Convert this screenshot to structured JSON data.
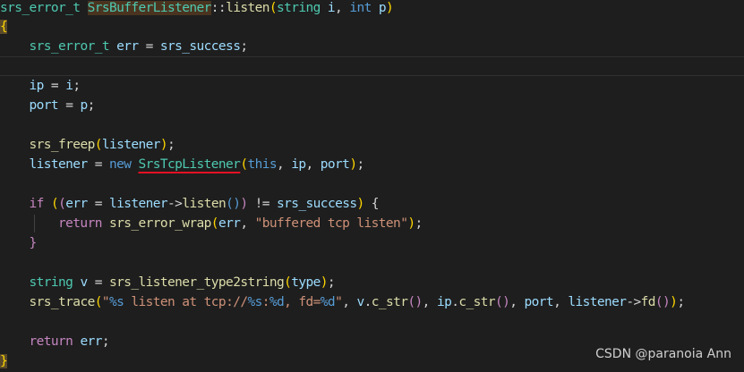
{
  "code": {
    "l1": {
      "ret_type": "srs_error_t",
      "class_name": "SrsBufferListener",
      "sep": "::",
      "method": "listen",
      "open": "(",
      "p1_type": "string",
      "p1_name": "i",
      "comma": ",",
      "p2_type": "int",
      "p2_name": "p",
      "close": ")"
    },
    "l2": {
      "brace": "{"
    },
    "l3": {
      "type": "srs_error_t",
      "var": "err",
      "eq": " = ",
      "val": "srs_success",
      "semi": ";"
    },
    "l5": {
      "lhs": "ip",
      "eq": " = ",
      "rhs": "i",
      "semi": ";"
    },
    "l6": {
      "lhs": "port",
      "eq": " = ",
      "rhs": "p",
      "semi": ";"
    },
    "l8": {
      "macro": "srs_freep",
      "open": "(",
      "arg": "listener",
      "close": ")",
      "semi": ";"
    },
    "l9": {
      "lhs": "listener",
      "eq": " = ",
      "kw_new": "new",
      "cls": "SrsTcpListener",
      "open": "(",
      "a1": "this",
      "c1": ", ",
      "a2": "ip",
      "c2": ", ",
      "a3": "port",
      "close": ")",
      "semi": ";"
    },
    "l11": {
      "kw_if": "if",
      "sp": " ",
      "open1": "(",
      "open2": "(",
      "err": "err",
      "eq": " = ",
      "obj": "listener",
      "arrow": "->",
      "call": "listen",
      "call_parens": "()",
      "close2": ")",
      "neq": " != ",
      "val": "srs_success",
      "close1": ")",
      "brace": " {"
    },
    "l12": {
      "kw_return": "return",
      "fn": "srs_error_wrap",
      "open": "(",
      "arg": "err",
      "comma": ", ",
      "str": "\"buffered tcp listen\"",
      "close": ")",
      "semi": ";"
    },
    "l13": {
      "brace": "}"
    },
    "l15": {
      "type": "string",
      "var": "v",
      "eq": " = ",
      "fn": "srs_listener_type2string",
      "open": "(",
      "arg": "type",
      "close": ")",
      "semi": ";"
    },
    "l16": {
      "fn": "srs_trace",
      "open": "(",
      "str1": "\"",
      "fmt1": "%s",
      "str2": " listen at tcp://",
      "fmt2": "%s",
      "str3": ":",
      "fmt3": "%d",
      "str4": ", fd=",
      "fmt4": "%d",
      "str5": "\"",
      "c1": ", ",
      "a1obj": "v",
      "a1dot": ".",
      "a1fn": "c_str",
      "a1p": "()",
      "c2": ", ",
      "a2obj": "ip",
      "a2dot": ".",
      "a2fn": "c_str",
      "a2p": "()",
      "c3": ", ",
      "a3": "port",
      "c4": ", ",
      "a4obj": "listener",
      "a4arrow": "->",
      "a4fn": "fd",
      "a4p": "()",
      "close": ")",
      "semi": ";"
    },
    "l18": {
      "kw_return": "return",
      "val": "err",
      "semi": ";"
    },
    "l19": {
      "brace": "}"
    }
  },
  "watermark": "CSDN @paranoia Ann"
}
